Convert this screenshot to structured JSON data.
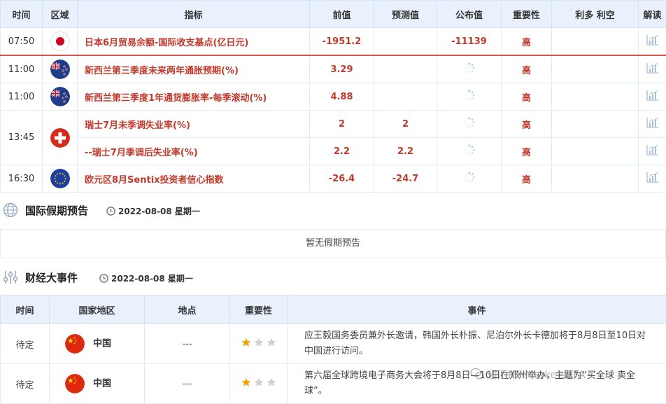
{
  "calendar": {
    "headers": [
      "时间",
      "区域",
      "指标",
      "前值",
      "预测值",
      "公布值",
      "重要性",
      "利多 利空",
      "解读"
    ],
    "rows": [
      {
        "time": "07:50",
        "flag": "japan",
        "indicator": "日本6月贸易余额-国际收支基点(亿日元)",
        "previous": "-1951.2",
        "forecast": "",
        "actual": "-11139",
        "importance": "高"
      },
      {
        "time": "11:00",
        "flag": "new-zealand",
        "indicator": "新西兰第三季度未来两年通胀预期(%)",
        "previous": "3.29",
        "forecast": "",
        "actual": "",
        "importance": "高"
      },
      {
        "time": "11:00",
        "flag": "new-zealand",
        "indicator": "新西兰第三季度1年通货膨胀率-每季滚动(%)",
        "previous": "4.88",
        "forecast": "",
        "actual": "",
        "importance": "高"
      },
      {
        "time": "13:45",
        "flag": "switzerland",
        "indicator": "瑞士7月未季调失业率(%)",
        "previous": "2",
        "forecast": "2",
        "actual": "",
        "importance": "高"
      },
      {
        "time": "",
        "flag": "",
        "indicator": "--瑞士7月季调后失业率(%)",
        "previous": "2.2",
        "forecast": "2.2",
        "actual": "",
        "importance": "高"
      },
      {
        "time": "16:30",
        "flag": "eu",
        "indicator": "欧元区8月Sentix投资者信心指数",
        "previous": "-26.4",
        "forecast": "-24.7",
        "actual": "",
        "importance": "高"
      }
    ]
  },
  "holiday": {
    "title": "国际假期预告",
    "date": "2022-08-08 星期一",
    "empty_text": "暂无假期预告"
  },
  "events": {
    "title": "财经大事件",
    "date": "2022-08-08 星期一",
    "headers": [
      "时间",
      "国家地区",
      "地点",
      "重要性",
      "事件"
    ],
    "rows": [
      {
        "time": "待定",
        "country": "中国",
        "location": "---",
        "stars": 1,
        "event": "应王毅国务委员兼外长邀请，韩国外长朴振、尼泊尔外长卡德加将于8月8日至10日对中国进行访问。"
      },
      {
        "time": "待定",
        "country": "中国",
        "location": "---",
        "stars": 1,
        "event": "第六届全球跨境电子商务大会将于8月8日—10日在郑州举办，主题为“买全球 卖全球”。"
      }
    ]
  },
  "watermark": "迈汇MHMarketsEFA",
  "colors": {
    "accent_red": "#c0392b",
    "header_bg": "#e9f2fc",
    "star_gold": "#f0a500",
    "star_gray": "#d0d0d0"
  }
}
